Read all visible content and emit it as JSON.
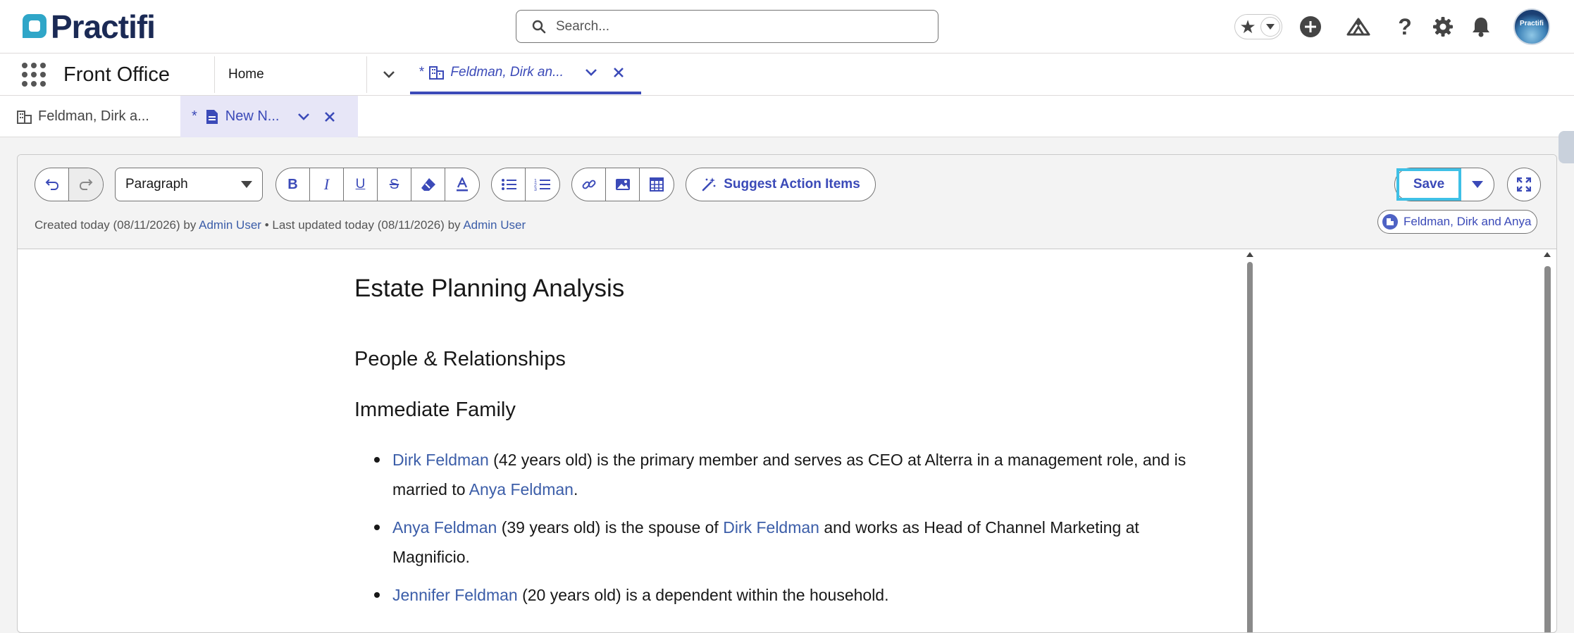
{
  "header": {
    "logo_text": "Practifi",
    "search": {
      "placeholder": "Search..."
    },
    "avatar_label": "Practifi"
  },
  "app_nav": {
    "app_name": "Front Office",
    "home_tab": "Home",
    "active_tab": {
      "prefix": "*",
      "label": "Feldman, Dirk an..."
    }
  },
  "subtabs": [
    {
      "label": "Feldman, Dirk a..."
    },
    {
      "prefix": "*",
      "label": "New N..."
    }
  ],
  "editor": {
    "paragraph_style": "Paragraph",
    "suggest_label": "Suggest Action Items",
    "save_label": "Save",
    "meta": {
      "created_prefix": "Created today (08/11/2026) by",
      "created_by": "Admin User",
      "updated_prefix": "• Last updated today (08/11/2026) by",
      "updated_by": "Admin User"
    },
    "related_record": "Feldman, Dirk and Anya"
  },
  "document": {
    "title": "Estate Planning Analysis",
    "section_heading": "People & Relationships",
    "subsection_heading": "Immediate Family",
    "bullets": [
      {
        "name1": "Dirk Feldman",
        "text1": " (42 years old) is the primary member and serves as CEO at Alterra in a management role, and is married to ",
        "name2": "Anya Feldman",
        "text2": "."
      },
      {
        "name1": "Anya Feldman",
        "text1": " (39 years old) is the spouse of ",
        "name2": "Dirk Feldman",
        "text2": " and works as Head of Channel Marketing at Magnificio."
      },
      {
        "name1": "Jennifer Feldman",
        "text1": " (20 years old) is a dependent within the household."
      }
    ]
  },
  "colors": {
    "accent": "#3b4ab8",
    "link": "#3b5da8",
    "focus_ring": "#3ec0e6",
    "logo_navy": "#1b2a55",
    "logo_teal": "#2fa6c8"
  }
}
